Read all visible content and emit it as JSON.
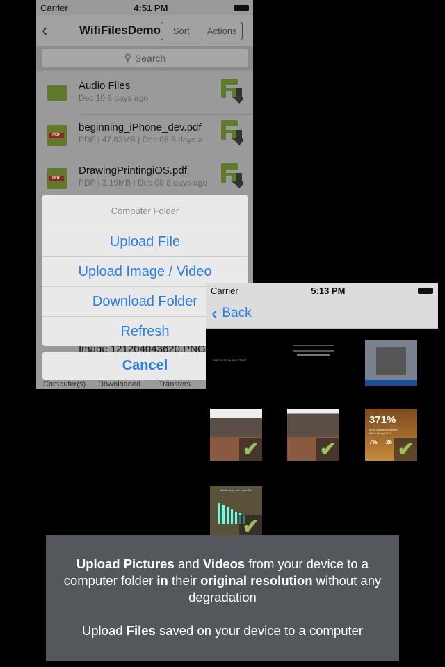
{
  "phone1": {
    "status": {
      "carrier": "Carrier",
      "time": "4:51 PM"
    },
    "nav": {
      "title": "WifiFilesDemo",
      "sort": "Sort",
      "actions": "Actions"
    },
    "search_placeholder": "Search",
    "files": [
      {
        "name": "Audio Files",
        "meta": "Dec 10    6 days ago",
        "type": "folder"
      },
      {
        "name": "beginning_iPhone_dev.pdf",
        "meta": "PDF | 47.63MB | Dec 08    8 days a…",
        "type": "pdf"
      },
      {
        "name": "DrawingPrintingiOS.pdf",
        "meta": "PDF | 3.19MB | Dec 08    8 days ago",
        "type": "pdf"
      }
    ],
    "pdf_badge": "PDF",
    "partial_row": "Image 121204043620.PNG",
    "action_sheet": {
      "title": "Computer Folder",
      "items": [
        "Upload File",
        "Upload Image / Video",
        "Download Folder",
        "Refresh"
      ],
      "cancel": "Cancel"
    },
    "tabs": [
      "Computer(s)",
      "Downloaded",
      "Transfers"
    ]
  },
  "phone2": {
    "status": {
      "carrier": "Carrier",
      "time": "5:13 PM"
    },
    "back": "Back",
    "thumbs": {
      "quickstart": "WIFI FILES QUICK START",
      "stat": "371%",
      "stat_sub": "more mobile customers Black Friday 2011",
      "stat2": "7%",
      "stat3": "26",
      "chart_title": "Mobile Apps Are Used For"
    }
  },
  "caption": {
    "p1": [
      [
        "Upload Pictures",
        true
      ],
      [
        " and ",
        false
      ],
      [
        "Videos",
        true
      ],
      [
        " from your device to a computer folder ",
        false
      ],
      [
        "in",
        true
      ],
      [
        " their ",
        false
      ],
      [
        "original resolution",
        true
      ],
      [
        " without any degradation",
        false
      ]
    ],
    "p2": [
      [
        "Upload ",
        false
      ],
      [
        "Files",
        true
      ],
      [
        " saved on your device to a computer",
        false
      ]
    ]
  },
  "colors": {
    "accent": "#2a7de1",
    "check": "#9ec05a",
    "caption_bg": "#54585d",
    "icon_green": "#5f7a2a"
  }
}
